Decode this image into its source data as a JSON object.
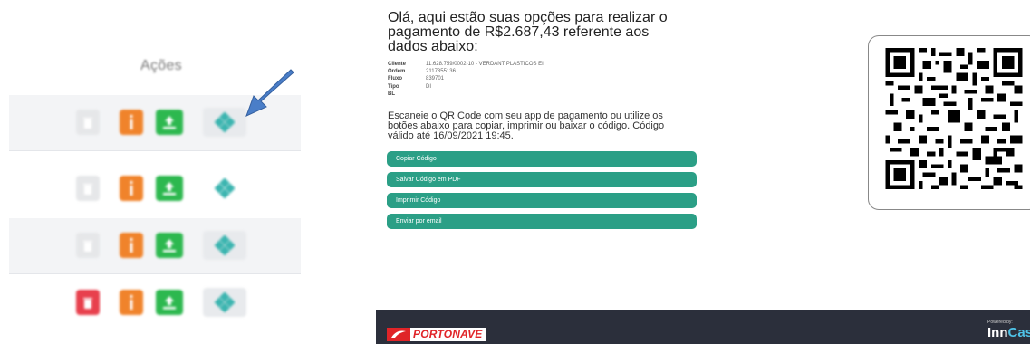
{
  "actions_panel": {
    "header": "Ações",
    "rows": [
      {
        "delete_active": false
      },
      {
        "delete_active": false
      },
      {
        "delete_active": false
      },
      {
        "delete_active": true
      }
    ]
  },
  "payment": {
    "title": "Olá, aqui estão suas opções para realizar o pagamento de R$2.687,43 referente aos dados abaixo:",
    "details": [
      {
        "label": "Cliente",
        "value": "11.628.759/0002-10 - VERDANT PLASTICOS EI"
      },
      {
        "label": "Ordem",
        "value": "2117355136"
      },
      {
        "label": "Fluxo",
        "value": "839701"
      },
      {
        "label": "Tipo",
        "value": "DI"
      },
      {
        "label": "BL",
        "value": ""
      }
    ],
    "instructions": "Escaneie o QR Code com seu app de pagamento ou utilize os botões abaixo para copiar, imprimir ou baixar o código. Código válido até 16/09/2021 19:45.",
    "buttons": {
      "copy": "Copiar Código",
      "save_pdf": "Salvar Código em PDF",
      "print": "Imprimir Código",
      "email": "Enviar por email"
    }
  },
  "footer": {
    "brand": "PORTONAVE",
    "powered_by": "Powered by:",
    "vendor_a": "Inn",
    "vendor_b": "Cas"
  },
  "colors": {
    "accent_green": "#2b9f86",
    "upload_green": "#2db84f",
    "info_orange": "#f0832b",
    "delete_red": "#e8404d",
    "footer_bg": "#2b2f3b",
    "arrow_blue": "#4a7ec8"
  }
}
